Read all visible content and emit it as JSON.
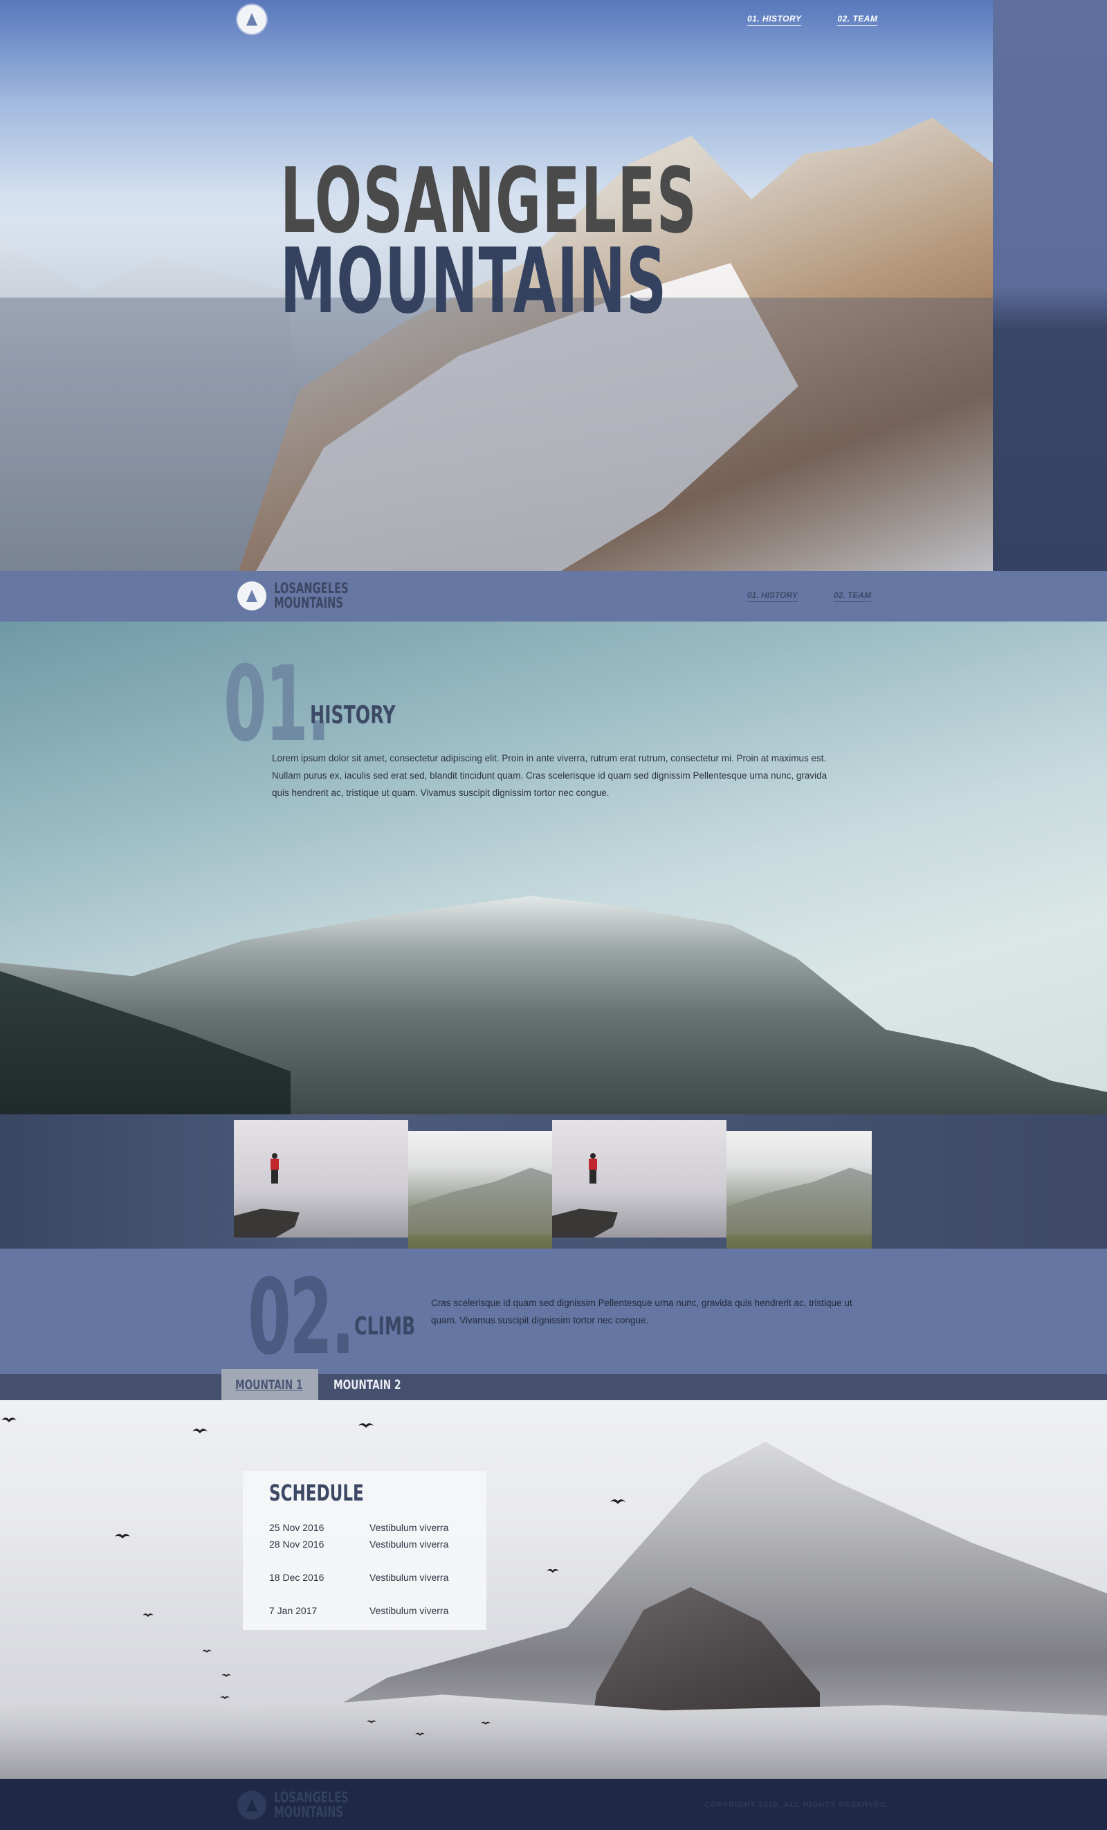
{
  "brand": {
    "line1": "LOSANGELES",
    "line2": "MOUNTAINS"
  },
  "hero": {
    "title_line1": "LOSANGELES",
    "title_line2": "MOUNTAINS",
    "nav": [
      {
        "label": "01. HISTORY"
      },
      {
        "label": "02. TEAM"
      }
    ]
  },
  "navbar": {
    "nav": [
      {
        "label": "01. HISTORY"
      },
      {
        "label": "02. TEAM"
      }
    ]
  },
  "history": {
    "number": "01.",
    "heading": "HISTORY",
    "text": "Lorem ipsum dolor sit amet, consectetur adipiscing elit. Proin in ante viverra, rutrum erat rutrum, consectetur mi. Proin at maximus est. Nullam purus ex, iaculis sed erat sed, blandit tincidunt quam. Cras scelerisque id quam sed dignissim Pellentesque urna nunc, gravida quis hendrerit ac, tristique ut quam. Vivamus suscipit dignissim tortor nec congue."
  },
  "climb": {
    "number": "02.",
    "heading": "CLIMB",
    "text": "Cras scelerisque id quam sed dignissim Pellentesque urna nunc, gravida quis hendrerit ac, tristique ut quam. Vivamus suscipit dignissim tortor nec congue."
  },
  "tabs": [
    {
      "label": "MOUNTAIN 1",
      "active": true
    },
    {
      "label": "MOUNTAIN 2",
      "active": false
    }
  ],
  "schedule": {
    "title": "SCHEDULE",
    "rows": [
      {
        "date": "25 Nov 2016",
        "event": "Vestibulum viverra"
      },
      {
        "date": "28 Nov 2016",
        "event": "Vestibulum viverra"
      },
      {
        "date": "18 Dec 2016",
        "event": "Vestibulum viverra"
      },
      {
        "date": "7 Jan 2017",
        "event": "Vestibulum viverra"
      }
    ]
  },
  "footer": {
    "copyright": "COPYRIGHT 2016. ALL RIGHTS RESERVED."
  },
  "colors": {
    "nav_bar": "#6677a3",
    "dark_accent": "#3d4a66",
    "footer": "#1d2947",
    "climber_jacket": "#c0262c"
  }
}
